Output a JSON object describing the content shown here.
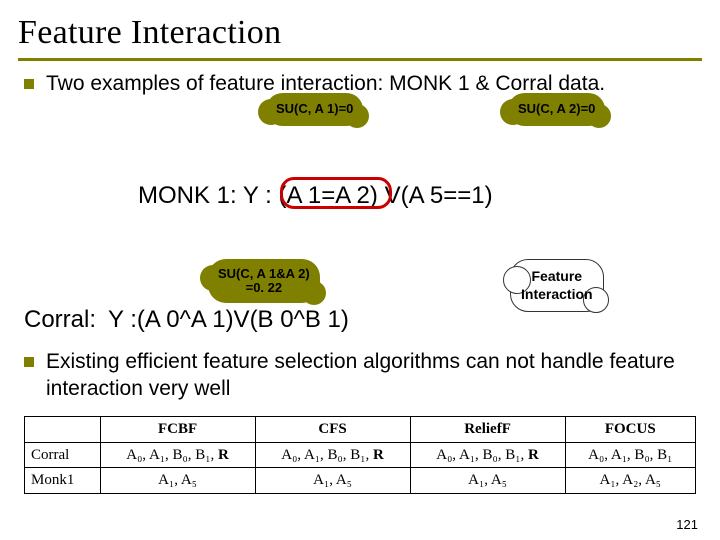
{
  "title": "Feature Interaction",
  "bullets": {
    "b1": "Two examples of feature interaction: MONK 1 & Corral data.",
    "b2": "Existing efficient feature selection algorithms can not handle feature interaction very well"
  },
  "clouds": {
    "su_a1": "SU(C, A 1)=0",
    "su_a2": "SU(C, A 2)=0",
    "su_a1a2_l1": "SU(C, A 1&A 2)",
    "su_a1a2_l2": "=0. 22",
    "feature_interaction_l1": "Feature",
    "feature_interaction_l2": "Interaction"
  },
  "formulas": {
    "monk_prefix": "MONK 1: Y :",
    "monk_circled": "(A 1=A 2)",
    "monk_suffix": "V(A 5==1)",
    "corral_label": "Corral:",
    "corral_expr": "Y :(A 0^A 1)V(B 0^B 1)"
  },
  "table": {
    "headers": [
      "",
      "FCBF",
      "CFS",
      "ReliefF",
      "FOCUS"
    ],
    "rows": [
      {
        "h": "Corral",
        "cells": [
          "A₀, A₁, B₀, B₁, R",
          "A₀, A₁, B₀, B₁, R",
          "A₀, A₁, B₀, B₁, R",
          "A₀, A₁, B₀, B₁"
        ]
      },
      {
        "h": "Monk1",
        "cells": [
          "A₁, A₅",
          "A₁, A₅",
          "A₁, A₅",
          "A₁, A₂, A₅"
        ]
      }
    ]
  },
  "pagenum": "121"
}
